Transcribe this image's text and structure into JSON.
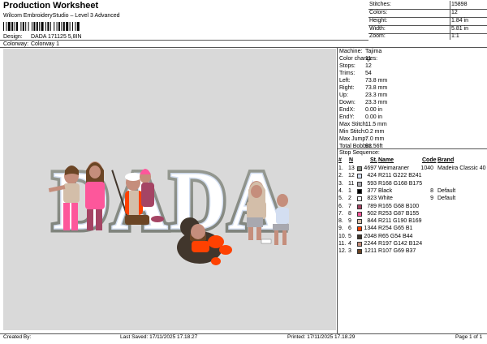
{
  "header": {
    "title": "Production Worksheet",
    "subtitle": "Wilcom EmbroideryStudio – Level 3 Advanced",
    "design_label": "Design:",
    "design_value": "DADA 171125 5,8IN",
    "colorway_label": "Colorway:",
    "colorway_value": "Colorway 1"
  },
  "stats": [
    {
      "label": "Stitches:",
      "value": "15898"
    },
    {
      "label": "Colors:",
      "value": "12"
    },
    {
      "label": "Height:",
      "value": "1.84 in"
    },
    {
      "label": "Width:",
      "value": "5.81 in"
    },
    {
      "label": "Zoom:",
      "value": "1:1"
    }
  ],
  "machine_info": [
    {
      "label": "Machine:",
      "value": "Tajima"
    },
    {
      "label": "Color changes:",
      "value": "11"
    },
    {
      "label": "Stops:",
      "value": "12"
    },
    {
      "label": "Trims:",
      "value": "54"
    },
    {
      "label": "Left:",
      "value": "73.8 mm"
    },
    {
      "label": "Right:",
      "value": "73.8 mm"
    },
    {
      "label": "Up:",
      "value": "23.3 mm"
    },
    {
      "label": "Down:",
      "value": "23.3 mm"
    },
    {
      "label": "EndX:",
      "value": "0.00 in"
    },
    {
      "label": "EndY:",
      "value": "0.00 in"
    },
    {
      "label": "Max Stitch:",
      "value": "11.5 mm"
    },
    {
      "label": "Min Stitch:",
      "value": "0.2 mm"
    },
    {
      "label": "Max Jump:",
      "value": "7.0 mm"
    },
    {
      "label": "Total Bobbin:",
      "value": "93.56ft"
    }
  ],
  "stop_sequence": {
    "title": "Stop Sequence:",
    "columns": [
      "#",
      "N",
      "St.",
      "Name",
      "Code",
      "Brand"
    ],
    "rows": [
      {
        "num": "1.",
        "n": "13",
        "st": "4697",
        "name": "Weimaraner",
        "code": "1040",
        "brand": "Madeira Classic 40",
        "color": "#8a8f86"
      },
      {
        "num": "2.",
        "n": "12",
        "st": "424",
        "name": "R211 G222 B241",
        "code": "",
        "brand": "",
        "color": "#d3def1"
      },
      {
        "num": "3.",
        "n": "11",
        "st": "593",
        "name": "R168 G168 B175",
        "code": "",
        "brand": "",
        "color": "#a8a8af"
      },
      {
        "num": "4.",
        "n": "1",
        "st": "377",
        "name": "Black",
        "code": "8",
        "brand": "Default",
        "color": "#000000"
      },
      {
        "num": "5.",
        "n": "2",
        "st": "823",
        "name": "White",
        "code": "9",
        "brand": "Default",
        "color": "#ffffff"
      },
      {
        "num": "6.",
        "n": "7",
        "st": "789",
        "name": "R165 G68 B100",
        "code": "",
        "brand": "",
        "color": "#a54464"
      },
      {
        "num": "7.",
        "n": "8",
        "st": "502",
        "name": "R253 G87 B155",
        "code": "",
        "brand": "",
        "color": "#fd579b"
      },
      {
        "num": "8.",
        "n": "9",
        "st": "844",
        "name": "R211 G190 B169",
        "code": "",
        "brand": "",
        "color": "#d3bea9"
      },
      {
        "num": "9.",
        "n": "6",
        "st": "1344",
        "name": "R254 G65 B1",
        "code": "",
        "brand": "",
        "color": "#fe4101"
      },
      {
        "num": "10.",
        "n": "5",
        "st": "2048",
        "name": "R65 G54 B44",
        "code": "",
        "brand": "",
        "color": "#41362c"
      },
      {
        "num": "11.",
        "n": "4",
        "st": "2244",
        "name": "R197 G142 B124",
        "code": "",
        "brand": "",
        "color": "#c58e7c"
      },
      {
        "num": "12.",
        "n": "3",
        "st": "1211",
        "name": "R107 G69 B37",
        "code": "",
        "brand": "",
        "color": "#6b4525"
      }
    ]
  },
  "design_text": "DADA",
  "footer": {
    "created_by": "Created By:",
    "last_saved": "Last Saved: 17/11/2025 17.18.27",
    "printed": "Printed: 17/11/2025 17.18.29",
    "page": "Page 1 of 1"
  }
}
